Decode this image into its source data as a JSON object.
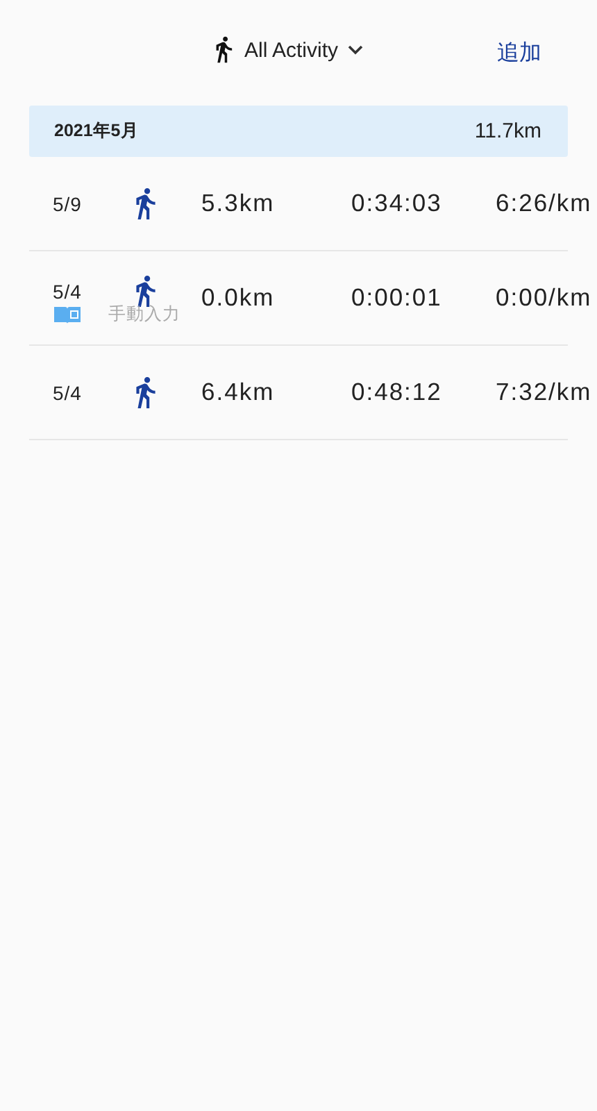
{
  "header": {
    "filter": "All Activity",
    "add": "追加"
  },
  "month": {
    "label": "2021年5月",
    "total": "11.7km"
  },
  "rows": [
    {
      "date": "5/9",
      "distance": "5.3km",
      "time": "0:34:03",
      "pace": "6:26/km"
    },
    {
      "date": "5/4",
      "distance": "0.0km",
      "time": "0:00:01",
      "pace": "0:00/km",
      "note": "手動入力"
    },
    {
      "date": "5/4",
      "distance": "6.4km",
      "time": "0:48:12",
      "pace": "7:32/km"
    }
  ]
}
